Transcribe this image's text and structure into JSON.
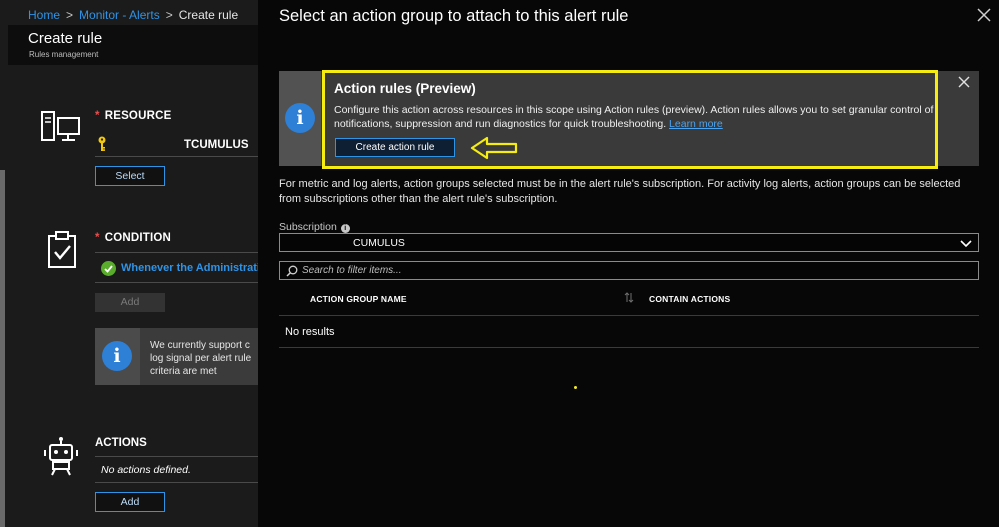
{
  "breadcrumb": [
    {
      "label": "Home"
    },
    {
      "label": "Monitor - Alerts"
    },
    {
      "label": "Create rule"
    }
  ],
  "left_blade": {
    "title": "Create rule",
    "subtitle": "Rules management",
    "resource": {
      "required_marker": "*",
      "label": "RESOURCE",
      "name": "TCUMULUS",
      "select_label": "Select",
      "icon": "server-icon"
    },
    "condition": {
      "required_marker": "*",
      "label": "CONDITION",
      "item": "Whenever the Administrati",
      "add_label": "Add",
      "icon": "clipboard-check-icon",
      "info_lines": [
        "We currently support c",
        "log signal per alert rule",
        "criteria are met"
      ]
    },
    "actions": {
      "label": "ACTIONS",
      "empty": "No actions defined.",
      "add_label": "Add",
      "icon": "robot-icon"
    }
  },
  "right_blade": {
    "title": "Select an action group to attach to this alert rule",
    "banner": {
      "title": "Action rules (Preview)",
      "text": "Configure this action across resources in this scope using Action rules (preview). Action rules allows you to set granular control of notifications, suppression and run diagnostics for quick troubleshooting.",
      "link": "Learn more",
      "button_label": "Create action rule"
    },
    "description": "For metric and log alerts, action groups selected must be in the alert rule's subscription. For activity log alerts, action groups can be selected from subscriptions other than the alert rule's subscription.",
    "subscription": {
      "label": "Subscription",
      "value": "CUMULUS"
    },
    "search": {
      "placeholder": "Search to filter items..."
    },
    "table": {
      "columns": [
        "ACTION GROUP NAME",
        "CONTAIN ACTIONS"
      ],
      "empty": "No results"
    }
  },
  "colors": {
    "accent": "#2f93e6",
    "highlight": "#f5ec12",
    "success": "#5aad2c",
    "required": "#e84e4e"
  }
}
